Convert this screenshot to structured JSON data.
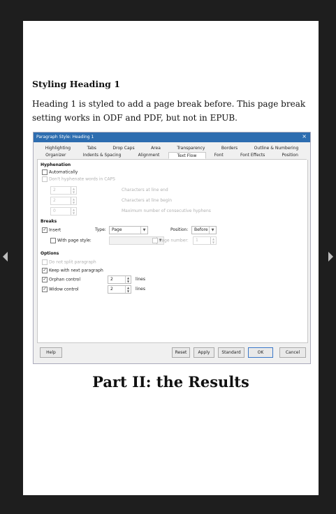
{
  "document": {
    "heading": "Styling Heading 1",
    "paragraph": "Heading 1 is styled to add a page break before. This page break setting works in ODF and PDF, but not in EPUB.",
    "part_title": "Part II: the Results"
  },
  "dialog": {
    "title": "Paragraph Style: Heading 1",
    "close_glyph": "×",
    "tabs_row1": [
      "Highlighting",
      "Tabs",
      "Drop Caps",
      "Area",
      "Transparency",
      "Borders",
      "Outline & Numbering"
    ],
    "tabs_row2": [
      "Organizer",
      "Indents & Spacing",
      "Alignment",
      "Text Flow",
      "Font",
      "Font Effects",
      "Position"
    ],
    "active_tab": "Text Flow",
    "hyphenation": {
      "section": "Hyphenation",
      "automatically": "Automatically",
      "caps": "Don't hyphenate words in CAPS",
      "line_end_value": "2",
      "line_end_label": "Characters at line end",
      "line_begin_value": "2",
      "line_begin_label": "Characters at line begin",
      "max_hyphens_value": "0",
      "max_hyphens_label": "Maximum number of consecutive hyphens"
    },
    "breaks": {
      "section": "Breaks",
      "insert": "Insert",
      "type_label": "Type:",
      "type_value": "Page",
      "position_label": "Position:",
      "position_value": "Before",
      "with_page_style": "With page style:",
      "page_number": "Page number:",
      "page_number_value": "1"
    },
    "options": {
      "section": "Options",
      "do_not_split": "Do not split paragraph",
      "keep_with_next": "Keep with next paragraph",
      "orphan": "Orphan control",
      "orphan_value": "2",
      "widow": "Widow control",
      "widow_value": "2",
      "lines": "lines"
    },
    "buttons": {
      "help": "Help",
      "reset": "Reset",
      "apply": "Apply",
      "standard": "Standard",
      "ok": "OK",
      "cancel": "Cancel"
    }
  },
  "colors": {
    "titlebar": "#2d6db0",
    "page_background": "#ffffff",
    "viewer_background": "#1e1e1e"
  }
}
